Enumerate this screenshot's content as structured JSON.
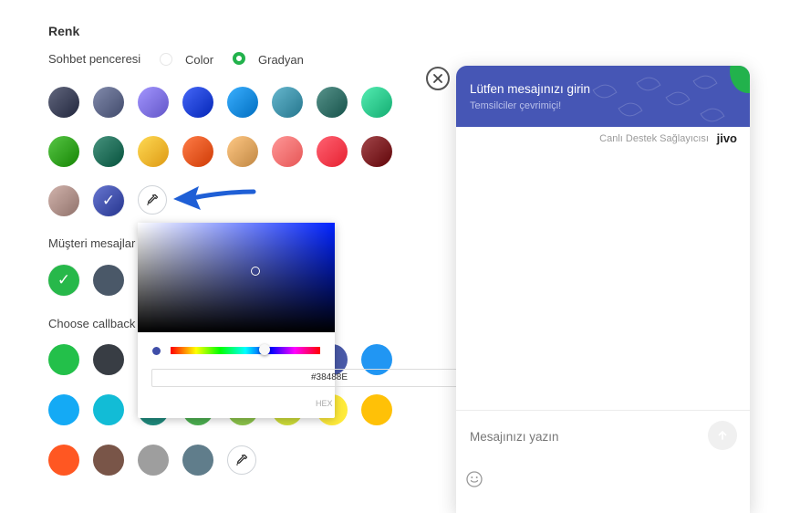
{
  "section": {
    "title": "Renk",
    "chat_window_label": "Sohbet penceresi",
    "mode_options": [
      {
        "label": "Color",
        "selected": false
      },
      {
        "label": "Gradyan",
        "selected": true
      }
    ],
    "customer_messages_label": "Müşteri mesajlar",
    "callback_label": "Choose callback"
  },
  "gradient_swatches": [
    "#3a3f56",
    "#5a6384",
    "#7b6ee0",
    "#1d3fd0",
    "#1287d9",
    "#3e8fa6",
    "#2f6b63",
    "#2cc58a",
    "#2f9e1d",
    "#1f6b56",
    "#f6b22c",
    "#e8541f",
    "#d9a05c",
    "#ff6f6f",
    "#ff3a4a",
    "#7a1e22",
    "#a98b84",
    "#3f4ea8"
  ],
  "customer_swatches": [
    "#27b84a",
    "#4a5868"
  ],
  "callback_swatches": [
    "#23c04a",
    "#383d44",
    "#4a5aa8",
    "#2196f3",
    "#14aaf5",
    "#12bcd6",
    "#1f8a7d",
    "#4caf50",
    "#8bc34a",
    "#cddc39",
    "#ffeb3b",
    "#ffc107",
    "#ff5722",
    "#795548",
    "#9e9e9e",
    "#607d8b"
  ],
  "color_picker": {
    "hex_value": "#38488E",
    "format_label": "HEX",
    "current_color": "#3f4ea8"
  },
  "chat_widget": {
    "title": "Lütfen mesajınızı girin",
    "subtitle": "Temsilciler çevrimiçi!",
    "provider_text": "Canlı Destek Sağlayıcısı",
    "brand": "jivo",
    "input_placeholder": "Mesajınızı yazın",
    "header_color": "#4656b5",
    "accent_color": "#22b24c"
  },
  "icons": [
    "eyedropper-icon",
    "checkmark-icon",
    "arrow-pointer-icon",
    "close-icon",
    "send-arrow-icon",
    "smiley-icon"
  ]
}
